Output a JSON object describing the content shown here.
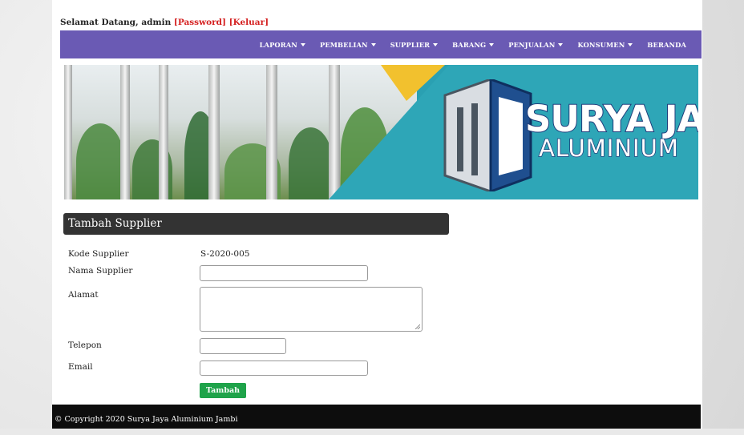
{
  "header": {
    "greeting": "Selamat Datang, admin",
    "password_link": "[Password]",
    "logout_link": "[Keluar]"
  },
  "nav": {
    "items": [
      {
        "label": "LAPORAN",
        "dropdown": true
      },
      {
        "label": "PEMBELIAN",
        "dropdown": true
      },
      {
        "label": "SUPPLIER",
        "dropdown": true
      },
      {
        "label": "BARANG",
        "dropdown": true
      },
      {
        "label": "PENJUALAN",
        "dropdown": true
      },
      {
        "label": "KONSUMEN",
        "dropdown": true
      },
      {
        "label": "BERANDA",
        "dropdown": false
      }
    ],
    "bg_color": "#6a5ab4"
  },
  "banner": {
    "brand_line1": "SURYA JAYA",
    "brand_line2": "ALUMINIUM",
    "accent_color": "#2ea6b7",
    "highlight_color": "#f2c12e"
  },
  "form": {
    "title": "Tambah Supplier",
    "kode_label": "Kode Supplier",
    "kode_value": "S-2020-005",
    "nama_label": "Nama Supplier",
    "nama_value": "",
    "alamat_label": "Alamat",
    "alamat_value": "",
    "telepon_label": "Telepon",
    "telepon_value": "",
    "email_label": "Email",
    "email_value": "",
    "submit_label": "Tambah",
    "submit_color": "#1fa34a"
  },
  "footer": {
    "text": "© Copyright 2020 Surya Jaya Aluminium Jambi"
  }
}
